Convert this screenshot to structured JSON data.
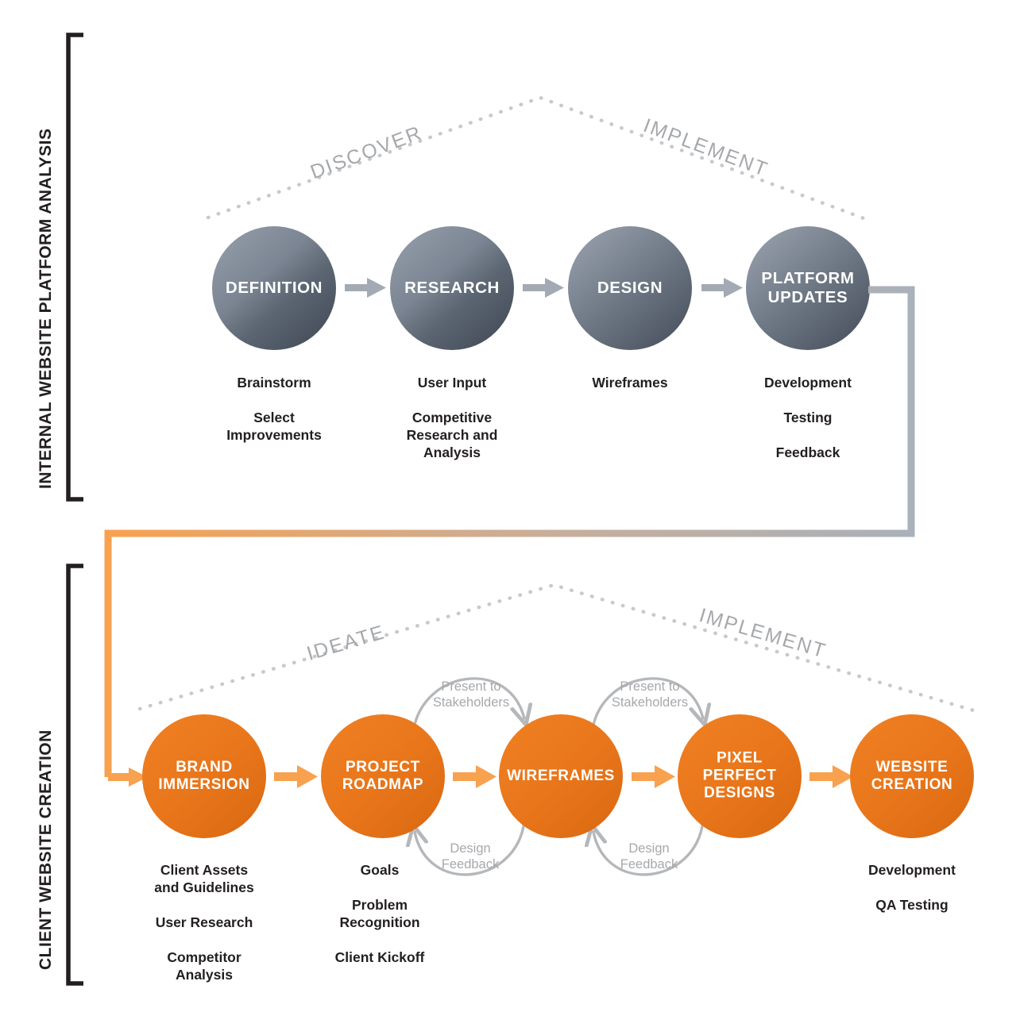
{
  "diagram": {
    "title_top": "INTERNAL WEBSITE PLATFORM ANALYSIS",
    "title_bottom": "CLIENT WEBSITE CREATION",
    "colors": {
      "gray_dark": "#4b5563",
      "gray_light": "#8d97a3",
      "gray_arrow": "#a3aab4",
      "orange": "#e8751a",
      "orange_light": "#f8a14f",
      "dotted": "#c7c9cb",
      "phase_text": "#a6a8ab",
      "body_text": "#231f20"
    }
  },
  "top_section": {
    "label": "INTERNAL WEBSITE PLATFORM ANALYSIS",
    "phases": [
      {
        "name": "DISCOVER"
      },
      {
        "name": "IMPLEMENT"
      }
    ],
    "nodes": [
      {
        "title": "DEFINITION",
        "caption": "Brainstorm\n\nSelect\nImprovements"
      },
      {
        "title": "RESEARCH",
        "caption": "User Input\n\nCompetitive\nResearch and\nAnalysis"
      },
      {
        "title": "DESIGN",
        "caption": "Wireframes"
      },
      {
        "title": "PLATFORM\nUPDATES",
        "caption": "Development\n\nTesting\n\nFeedback"
      }
    ]
  },
  "bottom_section": {
    "label": "CLIENT WEBSITE CREATION",
    "phases": [
      {
        "name": "IDEATE"
      },
      {
        "name": "IMPLEMENT"
      }
    ],
    "nodes": [
      {
        "title": "BRAND\nIMMERSION",
        "caption": "Client Assets\nand Guidelines\n\nUser Research\n\nCompetitor\nAnalysis"
      },
      {
        "title": "PROJECT\nROADMAP",
        "caption": "Goals\n\nProblem\nRecognition\n\nClient Kickoff"
      },
      {
        "title": "WIREFRAMES",
        "caption": ""
      },
      {
        "title": "PIXEL\nPERFECT\nDESIGNS",
        "caption": ""
      },
      {
        "title": "WEBSITE\nCREATION",
        "caption": "Development\n\nQA Testing"
      }
    ],
    "loops": [
      {
        "above": "Present to\nStakeholders",
        "below": "Design\nFeedback"
      },
      {
        "above": "Present to\nStakeholders",
        "below": "Design\nFeedback"
      }
    ]
  }
}
